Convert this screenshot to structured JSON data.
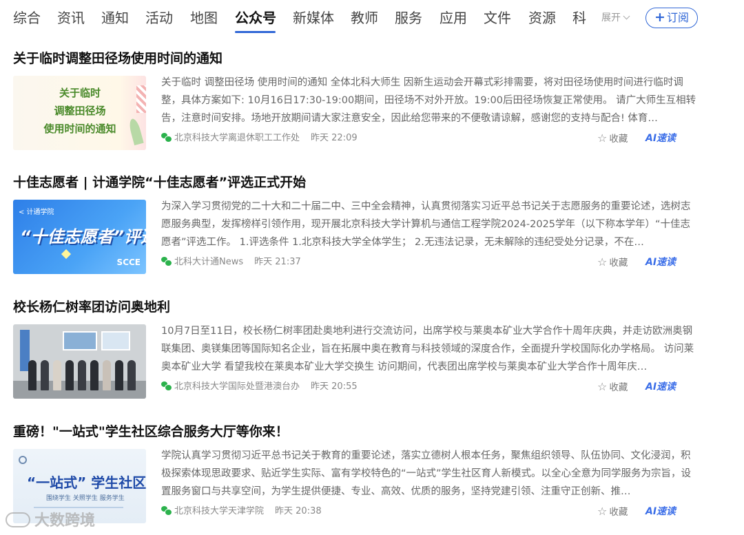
{
  "tabs": [
    {
      "label": "综合"
    },
    {
      "label": "资讯"
    },
    {
      "label": "通知"
    },
    {
      "label": "活动"
    },
    {
      "label": "地图"
    },
    {
      "label": "公众号"
    },
    {
      "label": "新媒体"
    },
    {
      "label": "教师"
    },
    {
      "label": "服务"
    },
    {
      "label": "应用"
    },
    {
      "label": "文件"
    },
    {
      "label": "资源"
    },
    {
      "label": "科"
    }
  ],
  "active_tab": "公众号",
  "expand_label": "展开",
  "subscribe_label": "订阅",
  "articles": [
    {
      "title": "关于临时调整田径场使用时间的通知",
      "excerpt": "关于临时 调整田径场 使用时间的通知 全体北科大师生 因新生运动会开幕式彩排需要，将对田径场使用时间进行临时调整，具体方案如下: 10月16日17:30-19:00期间，田径场不对外开放。19:00后田径场恢复正常使用。 请广大师生互相转告，注意时间安排。场地开放期间请大家注意安全，因此给您带来的不便敬请谅解，感谢您的支持与配合! 体育…",
      "source": "北京科技大学离退休职工工作处",
      "time": "昨天 22:09",
      "thumb_lines": [
        "关于临时",
        "调整田径场",
        "使用时间的通知"
      ]
    },
    {
      "title": "十佳志愿者 | 计通学院“十佳志愿者”评选正式开始",
      "excerpt": "为深入学习贯彻党的二十大和二十届二中、三中全会精神，认真贯彻落实习近平总书记关于志愿服务的重要论述，选树志愿服务典型，发挥榜样引领作用，现开展北京科技大学计算机与通信工程学院2024-2025学年（以下称本学年）“十佳志愿者”评选工作。 1.评选条件 1.北京科技大学全体学生； 2.无违法记录，无未解除的违纪受处分记录，不在…",
      "source": "北科大计通News",
      "time": "昨天 21:37",
      "thumb_tag": "< 计通学院",
      "thumb_main": "“十佳志愿者”评选",
      "thumb_sub": "SCCE"
    },
    {
      "title": "校长杨仁树率团访问奥地利",
      "excerpt": "10月7日至11日，校长杨仁树率团赴奥地利进行交流访问，出席学校与莱奥本矿业大学合作十周年庆典，并走访欧洲奥钢联集团、奥镁集团等国际知名企业，旨在拓展中奥在教育与科技领域的深度合作，全面提升学校国际化办学格局。 访问莱奥本矿业大学 看望我校在莱奥本矿业大学交换生 访问期间，代表团出席学校与莱奥本矿业大学合作十周年庆…",
      "source": "北京科技大学国际处暨港澳台办",
      "time": "昨天 20:55"
    },
    {
      "title": "重磅！\"一站式\"学生社区综合服务大厅等你来！",
      "excerpt": "学院认真学习贯彻习近平总书记关于教育的重要论述，落实立德树人根本任务，聚焦组织领导、队伍协同、文化浸润，积极探索体现思政要求、贴近学生实际、富有学校特色的“一站式”学生社区育人新模式。以全心全意为同学服务为宗旨，设置服务窗口与共享空间，为学生提供便捷、专业、高效、优质的服务，坚持党建引领、注重守正创新、推…",
      "source": "北京科技大学天津学院",
      "time": "昨天 20:38",
      "thumb_main": "“一站式” 学生社区",
      "thumb_sub": "围绕学生 关照学生 服务学生"
    }
  ],
  "favorite_label": "收藏",
  "ai_label": "AI速读",
  "watermark": "大数跨境",
  "colors": {
    "accent": "#2f66d6",
    "wechat_green": "#2bb24c",
    "ai_blue": "#3b6ee8"
  }
}
